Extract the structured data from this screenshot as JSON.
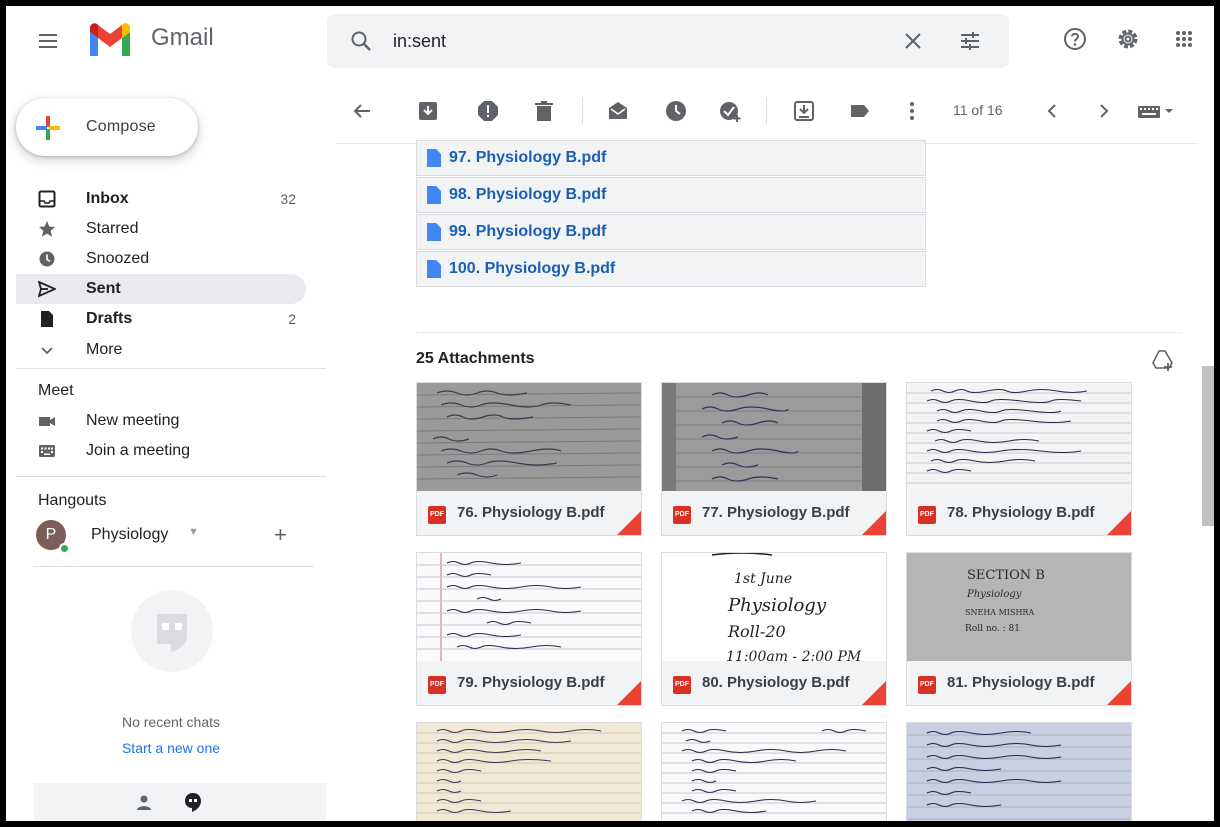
{
  "header": {
    "brand": "Gmail",
    "search_value": "in:sent",
    "icons": [
      "menu-icon",
      "search-icon",
      "clear-icon",
      "search-options-icon",
      "help-icon",
      "settings-icon",
      "apps-icon"
    ]
  },
  "sidebar": {
    "compose_label": "Compose",
    "items": [
      {
        "label": "Inbox",
        "count": "32",
        "icon": "inbox-icon",
        "bold": true
      },
      {
        "label": "Starred",
        "count": "",
        "icon": "star-icon"
      },
      {
        "label": "Snoozed",
        "count": "",
        "icon": "clock-icon"
      },
      {
        "label": "Sent",
        "count": "",
        "icon": "send-icon",
        "bold": true,
        "active": true
      },
      {
        "label": "Drafts",
        "count": "2",
        "icon": "draft-icon",
        "bold": true
      },
      {
        "label": "More",
        "count": "",
        "icon": "chevron-down-icon"
      }
    ],
    "meet": {
      "title": "Meet",
      "new_meeting": "New meeting",
      "join_meeting": "Join a meeting"
    },
    "hangouts": {
      "title": "Hangouts",
      "user_initial": "P",
      "user_name": "Physiology",
      "no_chats": "No recent chats",
      "start_new": "Start a new one"
    }
  },
  "toolbar": {
    "pager": "11 of 16",
    "icons": [
      "back-icon",
      "archive-icon",
      "report-spam-icon",
      "delete-icon",
      "mark-unread-icon",
      "snooze-icon",
      "add-task-icon",
      "move-to-icon",
      "label-icon",
      "more-icon",
      "older-icon",
      "newer-icon",
      "keyboard-icon"
    ]
  },
  "files": [
    {
      "name": "97. Physiology B.pdf"
    },
    {
      "name": "98. Physiology B.pdf"
    },
    {
      "name": "99. Physiology B.pdf"
    },
    {
      "name": "100. Physiology B.pdf"
    }
  ],
  "attachments": {
    "title": "25 Attachments",
    "badge": "PDF",
    "items": [
      {
        "name": "76. Physiology B.pdf",
        "style": "paper-gray"
      },
      {
        "name": "77. Physiology B.pdf",
        "style": "paper-gray-right"
      },
      {
        "name": "78. Physiology B.pdf",
        "style": "paper-white"
      },
      {
        "name": "79. Physiology B.pdf",
        "style": "paper-white"
      },
      {
        "name": "80. Physiology B.pdf",
        "style": "handwritten-cover"
      },
      {
        "name": "81. Physiology B.pdf",
        "style": "section-cover"
      },
      {
        "name": "",
        "style": "paper-cream"
      },
      {
        "name": "",
        "style": "paper-white"
      },
      {
        "name": "",
        "style": "paper-blue"
      }
    ]
  },
  "thumb_text": {
    "cover_line1": "1st June",
    "cover_line2": "Physiology",
    "cover_line3": "Roll-20",
    "cover_line4": "11:00am - 2:00 PM",
    "section_line1": "SECTION B",
    "section_line2": "Physiology",
    "section_line3": "SNEHA MISHRA",
    "section_line4": "Roll no. : 81"
  },
  "colors": {
    "accent_red": "#ea4335",
    "link_blue": "#1a73e8",
    "file_blue": "#1a5fb4",
    "active_bg": "#e8eaed"
  }
}
